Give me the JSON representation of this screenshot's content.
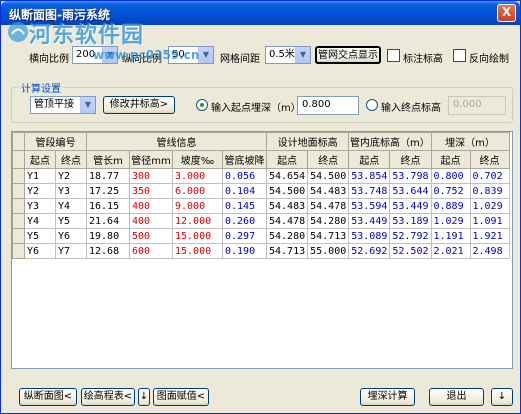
{
  "window": {
    "title": "纵断面图-雨污系统",
    "close": "X"
  },
  "watermark": {
    "text": "河东软件园",
    "url": "www.pc0359.cn"
  },
  "toolbar": {
    "h_scale_label": "横向比例",
    "h_scale_value": "200",
    "v_scale_label": "纵向比例",
    "v_scale_value": "50",
    "grid_label": "网格间距",
    "grid_value": "0.5米",
    "show_nodes_button": "管网交点显示",
    "mark_elev_label": "标注标高",
    "reverse_label": "反向绘制"
  },
  "calc": {
    "group_title": "计算设置",
    "mode_value": "管顶平接",
    "modify_button": "修改井标高>",
    "start_depth_label": "输入起点埋深（m）",
    "start_depth_value": "0.800",
    "end_elev_label": "输入终点标高",
    "end_elev_value": "0.000"
  },
  "table": {
    "groups": [
      "管段编号",
      "管线信息",
      "设计地面标高",
      "管内底标高（m）",
      "埋深（m）"
    ],
    "columns": [
      "起点",
      "终点",
      "管长m",
      "管径mm",
      "坡度‰",
      "管底坡降",
      "起点",
      "终点",
      "起点",
      "终点",
      "起点",
      "终点"
    ],
    "rows": [
      [
        "Y1",
        "Y2",
        "18.77",
        "300",
        "3.000",
        "0.056",
        "54.654",
        "54.500",
        "53.854",
        "53.798",
        "0.800",
        "0.702"
      ],
      [
        "Y2",
        "Y3",
        "17.25",
        "350",
        "6.000",
        "0.104",
        "54.500",
        "54.483",
        "53.748",
        "53.644",
        "0.752",
        "0.839"
      ],
      [
        "Y3",
        "Y4",
        "16.15",
        "400",
        "9.000",
        "0.145",
        "54.483",
        "54.478",
        "53.594",
        "53.449",
        "0.889",
        "1.029"
      ],
      [
        "Y4",
        "Y5",
        "21.64",
        "400",
        "12.000",
        "0.260",
        "54.478",
        "54.280",
        "53.449",
        "53.189",
        "1.029",
        "1.091"
      ],
      [
        "Y5",
        "Y6",
        "19.80",
        "500",
        "15.000",
        "0.297",
        "54.280",
        "54.713",
        "53.089",
        "52.792",
        "1.191",
        "1.921"
      ],
      [
        "Y6",
        "Y7",
        "12.68",
        "600",
        "15.000",
        "0.190",
        "54.713",
        "55.000",
        "52.692",
        "52.502",
        "2.021",
        "2.498"
      ]
    ]
  },
  "bottom": {
    "profile_button": "纵断面图<",
    "draw_elev_button": "绘高程表<",
    "down_arrow": "↓",
    "assign_button": "图面赋值<",
    "calc_button": "埋深计算",
    "exit_button": "退出",
    "down_arrow2": "↓"
  },
  "colors": {
    "red_values": "#e00000",
    "blue_values": "#0000c0",
    "title_bar": "#0453d6"
  }
}
